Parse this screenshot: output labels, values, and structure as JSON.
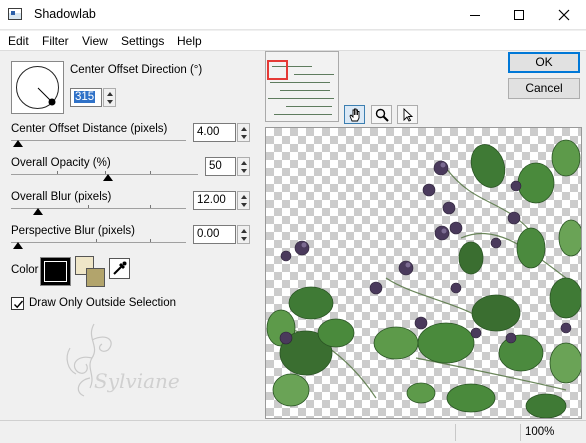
{
  "window": {
    "title": "Shadowlab"
  },
  "menu": [
    "Edit",
    "Filter",
    "View",
    "Settings",
    "Help"
  ],
  "controls": {
    "direction": {
      "label": "Center Offset Direction (°)",
      "value": "315"
    },
    "distance": {
      "label": "Center Offset Distance (pixels)",
      "value": "4.00"
    },
    "opacity": {
      "label": "Overall Opacity (%)",
      "value": "50"
    },
    "blur": {
      "label": "Overall Blur (pixels)",
      "value": "12.00"
    },
    "perspective": {
      "label": "Perspective Blur (pixels)",
      "value": "0.00"
    },
    "color": {
      "label": "Color",
      "swatch": "#000000",
      "fg": "#efe6c8",
      "bg": "#b2a46c"
    },
    "draw_only_outside": {
      "label": "Draw Only Outside Selection",
      "checked": true
    }
  },
  "watermark": {
    "text": "Sylviane"
  },
  "buttons": {
    "ok": "OK",
    "cancel": "Cancel"
  },
  "tools": [
    "hand-icon",
    "zoom-icon",
    "pointer-icon"
  ],
  "status": {
    "zoom": "100%"
  },
  "colors": {
    "accent": "#0078d7",
    "selection": "#3072c8",
    "leaf": "#3f7a35",
    "flower": "#4a3a5c"
  }
}
